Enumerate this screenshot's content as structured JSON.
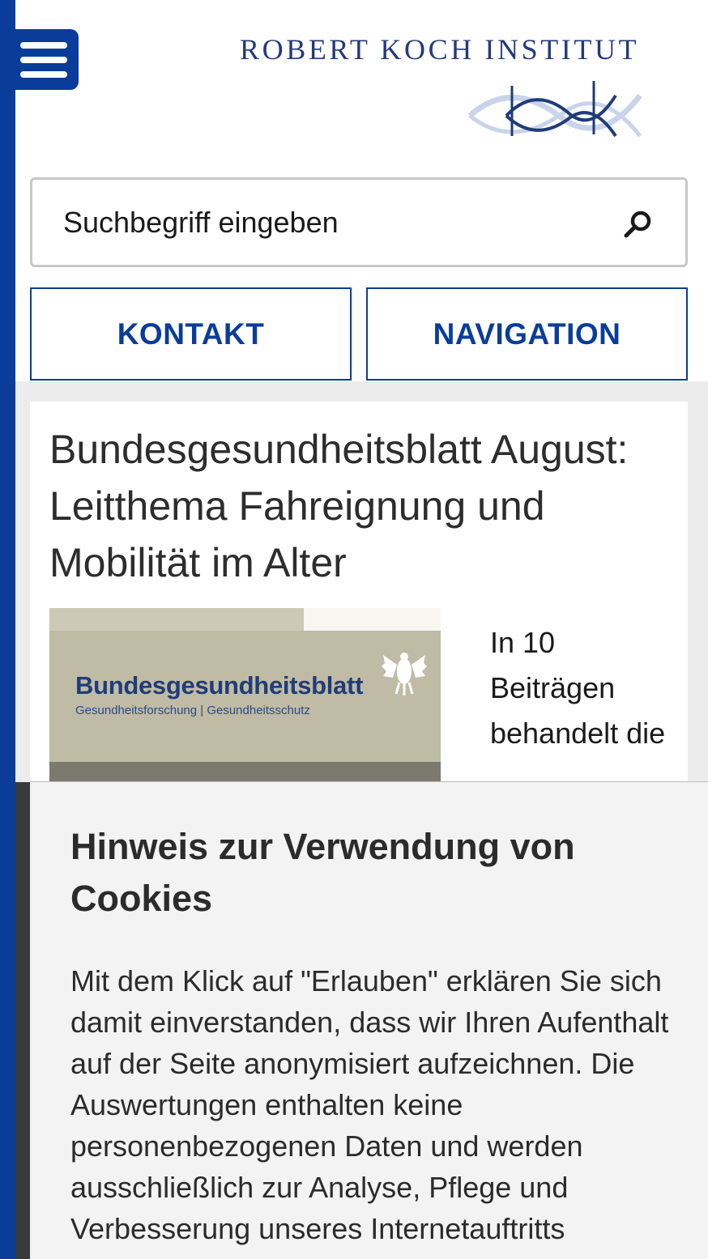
{
  "header": {
    "menu_icon": "hamburger-menu-icon",
    "logo_text": "ROBERT KOCH INSTITUT"
  },
  "search": {
    "placeholder": "Suchbegriff eingeben",
    "icon": "magnifier-icon"
  },
  "buttons": {
    "kontakt": "KONTAKT",
    "navigation": "NAVIGATION"
  },
  "article": {
    "title": "Bundesgesundheitsblatt August: Leitthema Fahreignung und Mobilität im Alter",
    "cover": {
      "title": "Bundesgesundheitsblatt",
      "subtitle": "Gesundheitsforschung | Gesundheitsschutz"
    },
    "teaser": "In 10 Beiträgen behandelt die"
  },
  "cookie_notice": {
    "title": "Hinweis zur Verwendung von Cookies",
    "text": "Mit dem Klick auf \"Erlauben\" erklären Sie sich damit einverstanden, dass wir Ihren Aufenthalt auf der Seite anonymisiert aufzeichnen. Die Auswertungen enthalten keine personenbezogenen Daten und werden ausschließlich zur Analyse, Pflege und Verbesserung unseres Internetauftritts"
  },
  "colors": {
    "brand_blue": "#0a3d9a",
    "logo_blue": "#233a7c",
    "content_background": "#ececec",
    "cookie_background": "#f3f3f3"
  }
}
